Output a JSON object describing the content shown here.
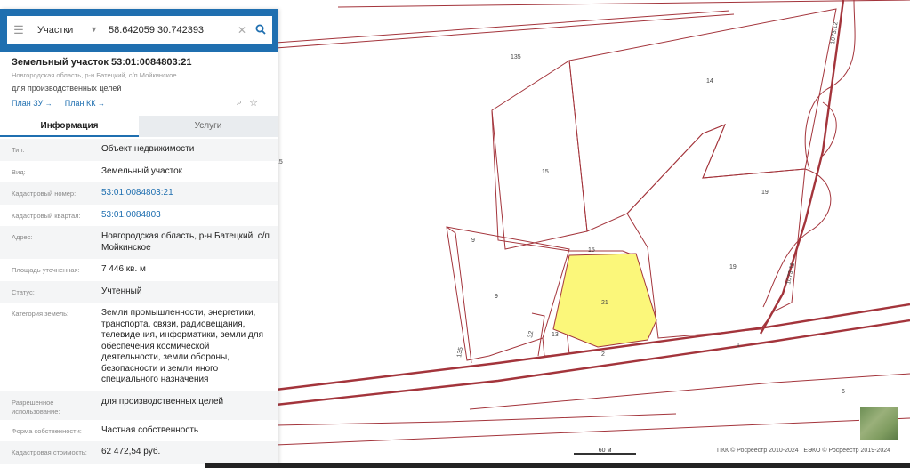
{
  "search": {
    "type_label": "Участки",
    "query": "58.642059 30.742393"
  },
  "parcel": {
    "title": "Земельный участок 53:01:0084803:21",
    "location": "Новгородская область, р-н Батецкий, с/п Мойкинское",
    "purpose": "для производственных целей",
    "plan_zu": "План ЗУ",
    "plan_kk": "План КК"
  },
  "tabs": [
    {
      "label": "Информация"
    },
    {
      "label": "Услуги"
    }
  ],
  "rows": [
    {
      "label": "Тип:",
      "value": "Объект недвижимости"
    },
    {
      "label": "Вид:",
      "value": "Земельный участок"
    },
    {
      "label": "Кадастровый номер:",
      "value": "53:01:0084803:21"
    },
    {
      "label": "Кадастровый квартал:",
      "value": "53:01:0084803"
    },
    {
      "label": "Адрес:",
      "value": "Новгородская область, р-н Батецкий, с/п Мойкинское"
    },
    {
      "label": "Площадь уточненная:",
      "value": "7 446 кв. м"
    },
    {
      "label": "Статус:",
      "value": "Учтенный"
    },
    {
      "label": "Категория земель:",
      "value": "Земли промышленности, энергетики, транспорта, связи, радиовещания, телевидения, информатики, земли для обеспечения космической деятельности, земли обороны, безопасности и земли иного специального назначения"
    },
    {
      "label": "Разрешенное использование:",
      "value": "для производственных целей"
    },
    {
      "label": "Форма собственности:",
      "value": "Частная собственность"
    },
    {
      "label": "Кадастровая стоимость:",
      "value": "62 472,54 руб."
    }
  ],
  "map": {
    "labels": [
      "135",
      "14",
      "15",
      "19",
      "15",
      "19",
      "9",
      "9",
      "21",
      "13",
      "32",
      "2",
      "1",
      "6",
      "135",
      "15",
      "1073:11",
      "1073:12"
    ],
    "selected_color": "#fbf77a",
    "boundary_color": "#a3343b"
  },
  "scale_label": "60 м",
  "attribution": "ПКК © Росреестр 2010-2024 | ЕЭКО © Росреестр 2019-2024"
}
